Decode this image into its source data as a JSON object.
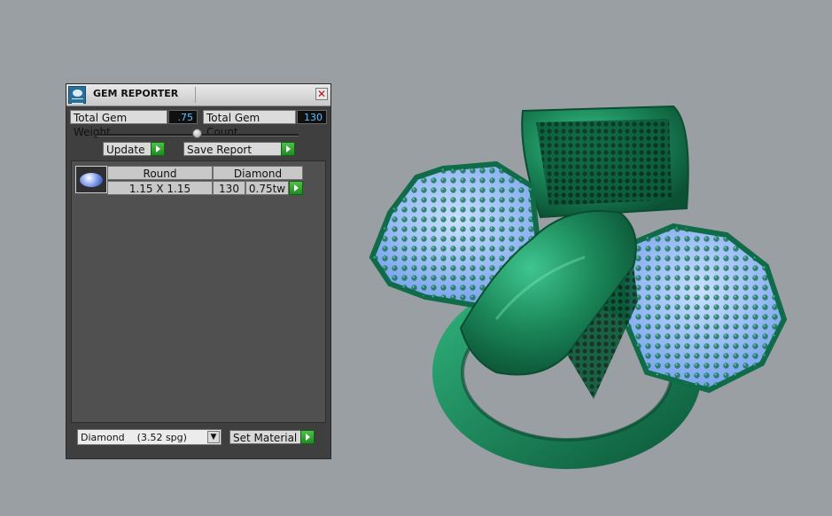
{
  "panel": {
    "title": "GEM REPORTER",
    "close_glyph": "✕",
    "total_gem_weight_label": "Total Gem Weight",
    "total_gem_weight_value": ".75",
    "total_gem_count_label": "Total Gem Count",
    "total_gem_count_value": "130",
    "update_label": "Update",
    "save_report_label": "Save Report",
    "table": {
      "headers": [
        "Round",
        "Diamond"
      ],
      "rows": [
        {
          "size": "1.15 X 1.15",
          "count": "130",
          "weight": "0.75tw"
        }
      ]
    },
    "material_select": {
      "value": "Diamond",
      "spg": "(3.52 spg)",
      "arrow": "▼"
    },
    "set_material_label": "Set Material"
  },
  "icons": {
    "app": "gem-reporter-icon",
    "close": "close-icon",
    "go": "green-arrow-icon",
    "gem": "round-gem-icon"
  },
  "colors": {
    "viewport_bg": "#9a9fa4",
    "panel_bg": "#3f3f3f",
    "ring_metal": "#1f8a5a",
    "gem_stones": "#8ec0ff",
    "value_text": "#5fc0ff",
    "go_button": "#2fa32f"
  }
}
